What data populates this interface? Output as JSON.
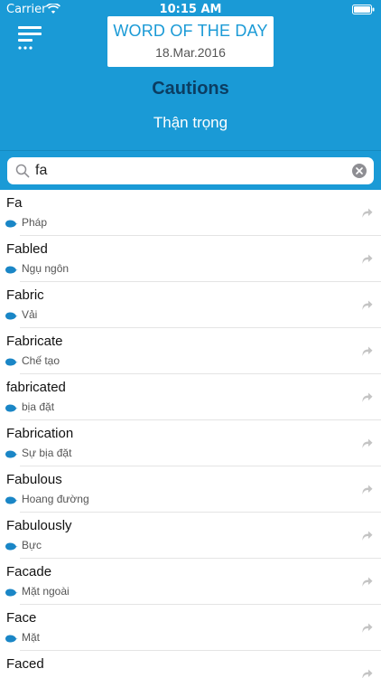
{
  "status_bar": {
    "carrier": "Carrier",
    "time": "10:15 AM"
  },
  "word_of_the_day": {
    "title": "WORD OF THE DAY",
    "date": "18.Mar.2016",
    "word": "Cautions",
    "meaning": "Thận trọng"
  },
  "search": {
    "value": "fa",
    "placeholder": ""
  },
  "results": [
    {
      "word": "Fa",
      "meaning": "Pháp"
    },
    {
      "word": "Fabled",
      "meaning": "Ngụ ngôn"
    },
    {
      "word": "Fabric",
      "meaning": "Vải"
    },
    {
      "word": "Fabricate",
      "meaning": "Chế tạo"
    },
    {
      "word": "fabricated",
      "meaning": "bịa đặt"
    },
    {
      "word": "Fabrication",
      "meaning": "Sự bịa đặt"
    },
    {
      "word": "Fabulous",
      "meaning": "Hoang đường"
    },
    {
      "word": "Fabulously",
      "meaning": "Bực"
    },
    {
      "word": "Facade",
      "meaning": "Mặt ngoài"
    },
    {
      "word": "Face",
      "meaning": "Mặt"
    },
    {
      "word": "Faced",
      "meaning": ""
    }
  ],
  "icons": {
    "menu": "menu-icon",
    "search": "search-icon",
    "clear": "clear-icon",
    "meaning": "speech-bubble-icon",
    "share": "share-arrow-icon",
    "wifi": "wifi-icon",
    "battery": "battery-icon"
  },
  "colors": {
    "accent": "#1a9ad6",
    "word_title": "#0b3d62",
    "meaning_bubble": "#1a86c6"
  }
}
